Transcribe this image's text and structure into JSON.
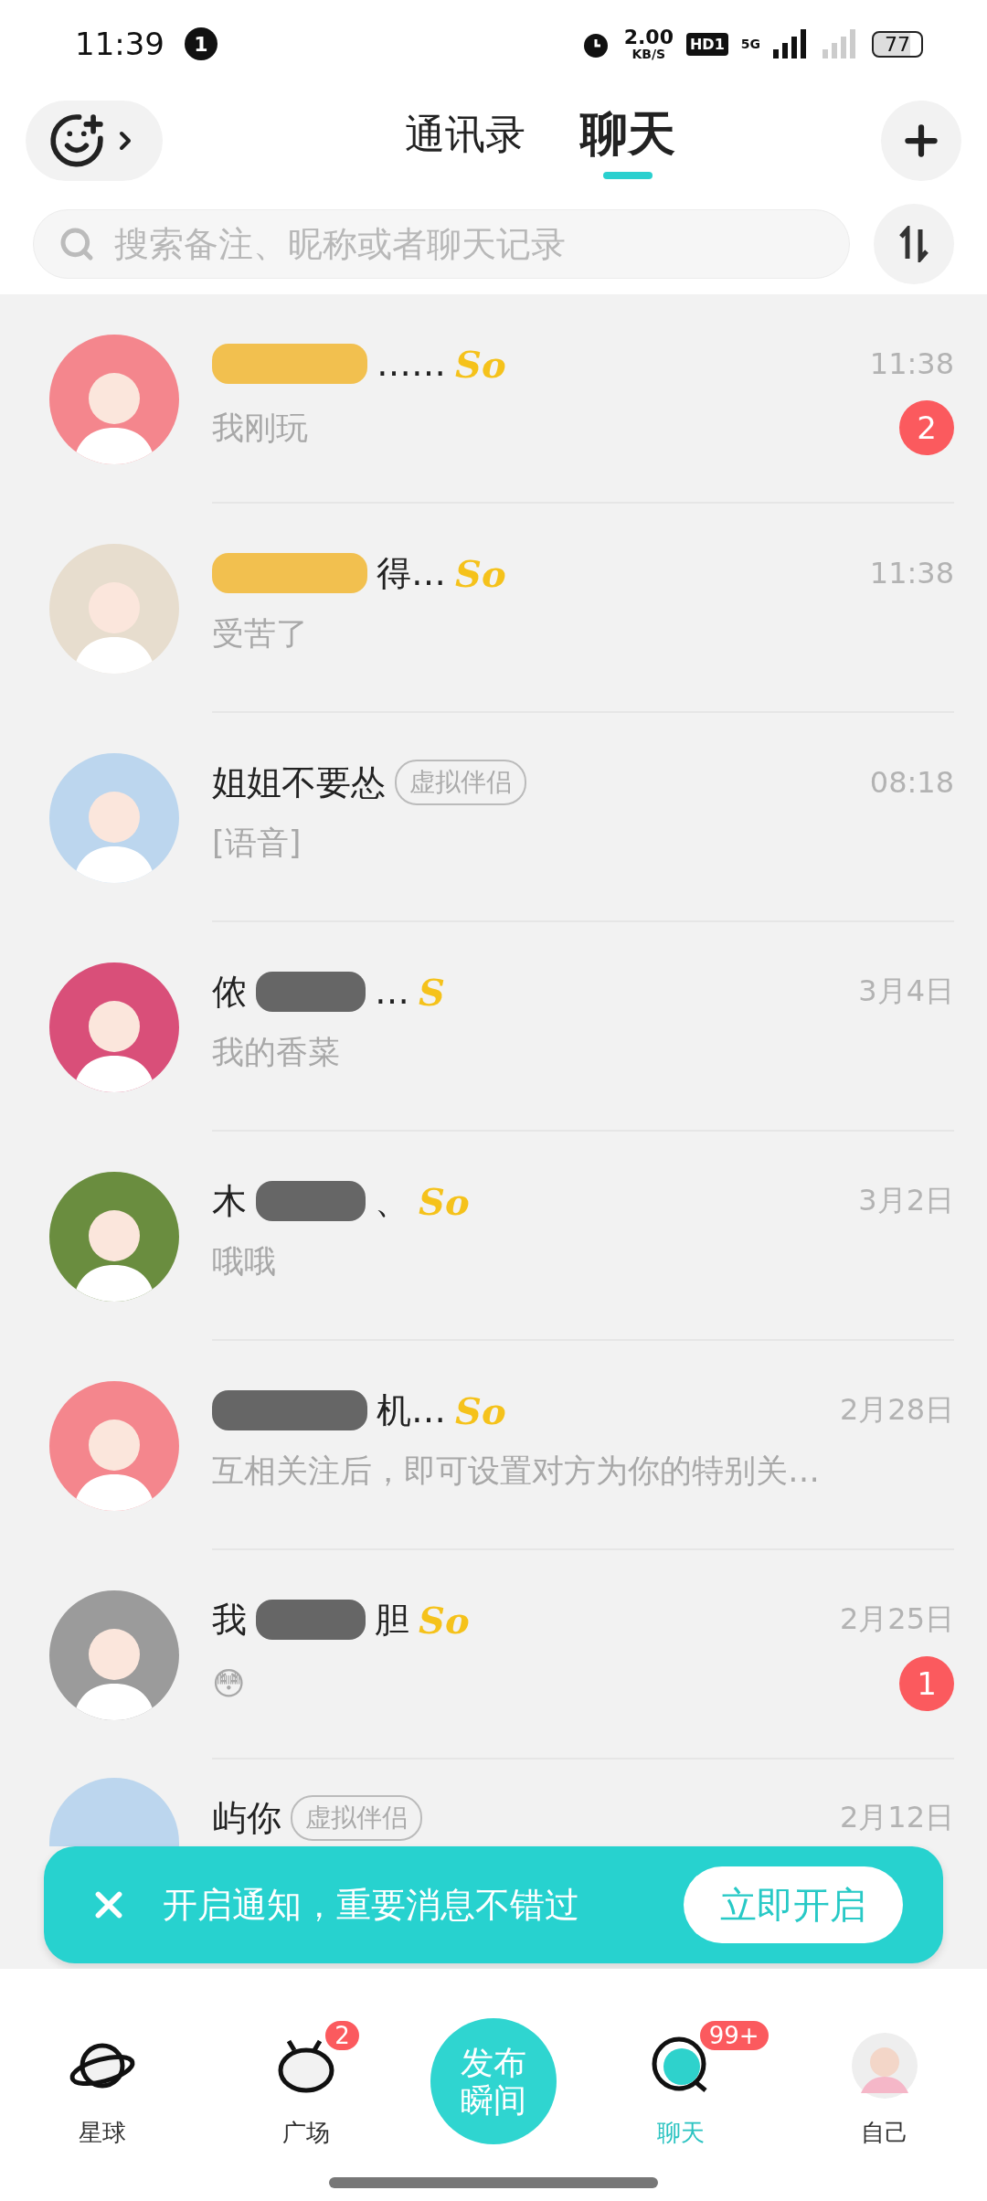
{
  "status_bar": {
    "time": "11:39",
    "notification_count": "1",
    "speed": "2.00",
    "speed_unit": "KB/S",
    "hd": "HD1",
    "network": "5G",
    "battery": "77"
  },
  "header": {
    "tabs": [
      {
        "label": "通讯录",
        "selected": false
      },
      {
        "label": "聊天",
        "selected": true
      }
    ]
  },
  "search": {
    "placeholder": "搜索备注、昵称或者聊天记录"
  },
  "chats": [
    {
      "redacted": true,
      "color": "#f2c04f",
      "name_after": "……",
      "mark": "So",
      "time": "11:38",
      "preview": "我刚玩",
      "unread": "2"
    },
    {
      "redacted": true,
      "color": "#f2c04f",
      "name_after": "得…",
      "mark": "So",
      "time": "11:38",
      "preview": "受苦了"
    },
    {
      "name_before": "姐姐不要怂",
      "tag": "虚拟伴侣",
      "time": "08:18",
      "preview": "[语音]"
    },
    {
      "name_before": "侬",
      "redacted": true,
      "color": "#666666",
      "name_after": "…",
      "mark": "S",
      "time": "3月4日",
      "preview": "我的香菜"
    },
    {
      "name_before": "木",
      "redacted": true,
      "color": "#666666",
      "name_after": "、",
      "mark": "So",
      "time": "3月2日",
      "preview": "哦哦"
    },
    {
      "redacted": true,
      "color": "#666666",
      "name_after": "机…",
      "mark": "So",
      "time": "2月28日",
      "preview": "互相关注后，即可设置对方为你的特别关…"
    },
    {
      "name_before": "我",
      "redacted": true,
      "color": "#666666",
      "name_after": "胆",
      "mark": "So",
      "time": "2月25日",
      "preview": "😳",
      "unread": "1"
    },
    {
      "name_before": "屿你",
      "tag": "虚拟伴侣",
      "time": "2月12日"
    }
  ],
  "banner": {
    "text": "开启通知，重要消息不错过",
    "button": "立即开启"
  },
  "nav": [
    {
      "kind": "planet",
      "label": "星球",
      "selected": false
    },
    {
      "kind": "square",
      "label": "广场",
      "badge": "2",
      "selected": false
    },
    {
      "kind": "post",
      "label": "发布瞬间"
    },
    {
      "kind": "chat",
      "label": "聊天",
      "badge": "99+",
      "selected": true
    },
    {
      "kind": "me",
      "label": "自己",
      "selected": false
    }
  ]
}
